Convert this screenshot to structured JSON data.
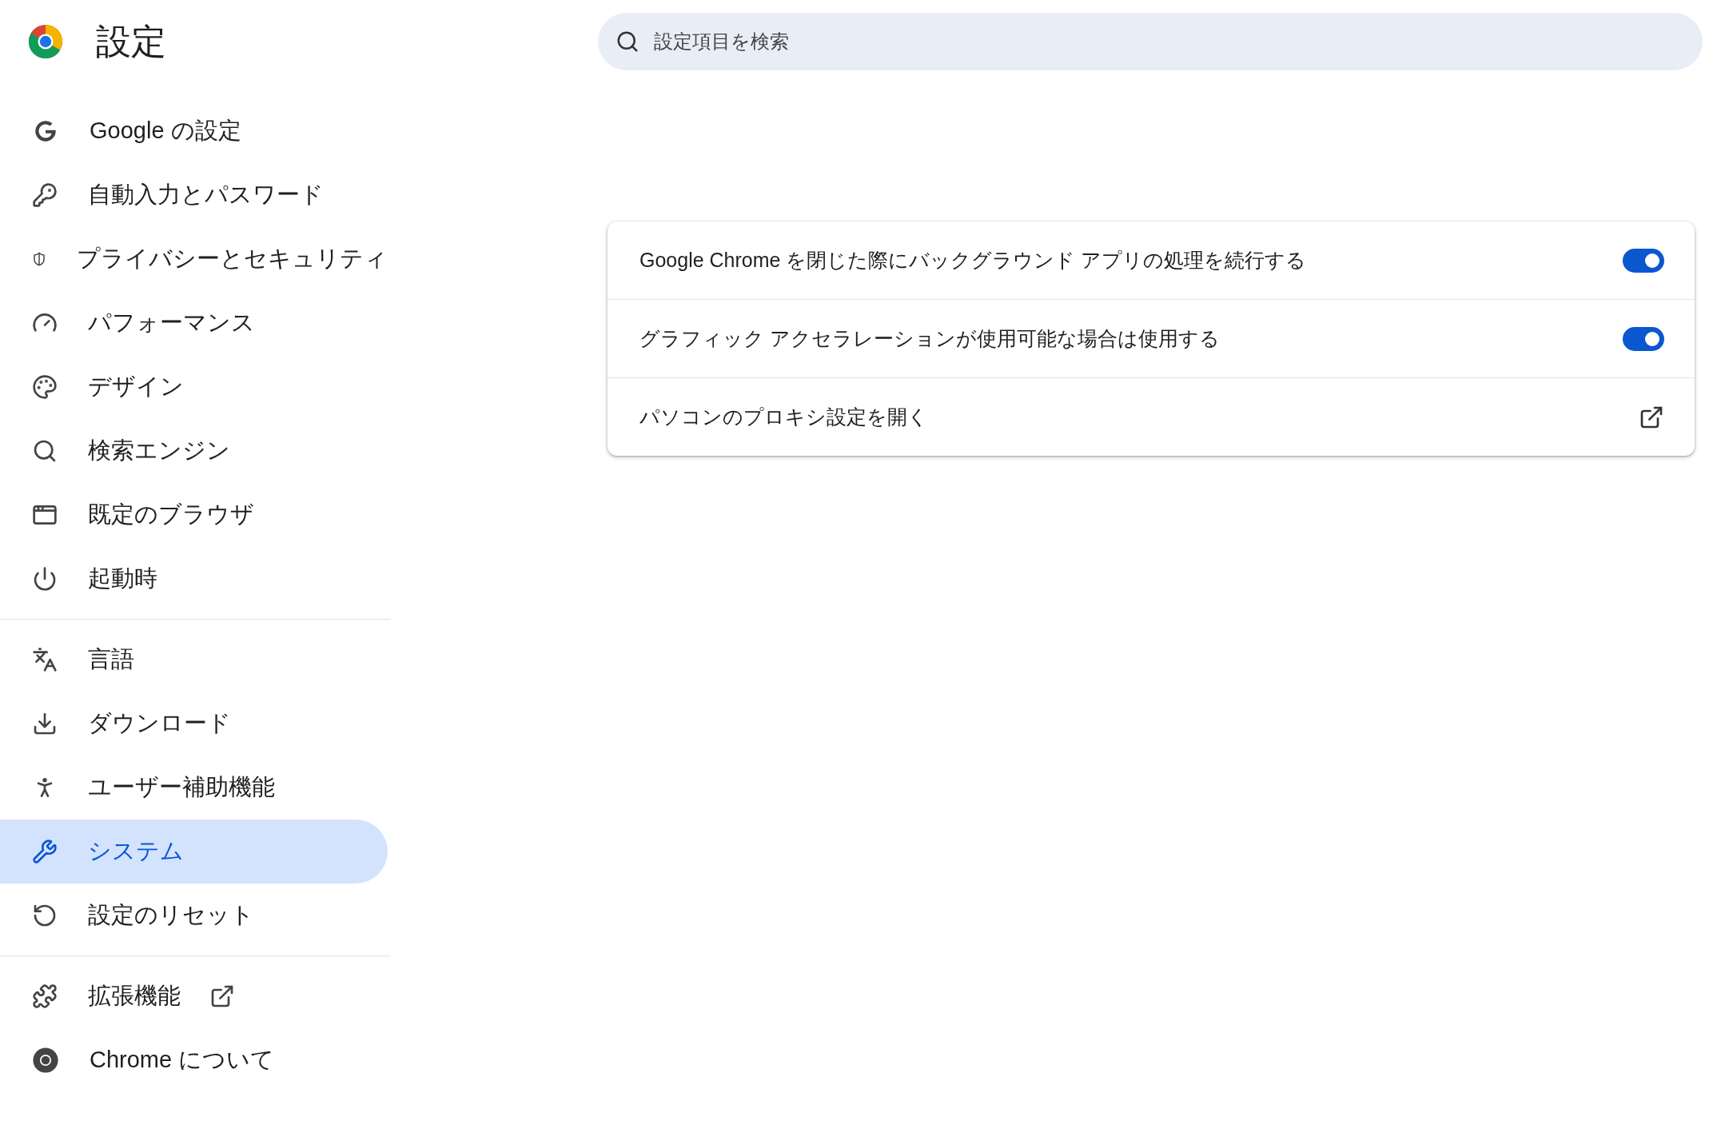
{
  "header": {
    "title": "設定",
    "search": {
      "placeholder": "設定項目を検索"
    }
  },
  "sidebar": {
    "groups": [
      {
        "items": [
          {
            "label": "Google の設定",
            "selected": false
          },
          {
            "label": "自動入力とパスワード",
            "selected": false
          },
          {
            "label": "プライバシーとセキュリティ",
            "selected": false
          },
          {
            "label": "パフォーマンス",
            "selected": false
          },
          {
            "label": "デザイン",
            "selected": false
          },
          {
            "label": "検索エンジン",
            "selected": false
          },
          {
            "label": "既定のブラウザ",
            "selected": false
          },
          {
            "label": "起動時",
            "selected": false
          }
        ]
      },
      {
        "items": [
          {
            "label": "言語",
            "selected": false
          },
          {
            "label": "ダウンロード",
            "selected": false
          },
          {
            "label": "ユーザー補助機能",
            "selected": false
          },
          {
            "label": "システム",
            "selected": true
          },
          {
            "label": "設定のリセット",
            "selected": false
          }
        ]
      },
      {
        "items": [
          {
            "label": "拡張機能",
            "selected": false,
            "external": true
          },
          {
            "label": "Chrome について",
            "selected": false
          }
        ]
      }
    ]
  },
  "settings": [
    {
      "kind": "toggle",
      "label": "Google Chrome を閉じた際にバックグラウンド アプリの処理を続行する",
      "on": true
    },
    {
      "kind": "toggle",
      "label": "グラフィック アクセラレーションが使用可能な場合は使用する",
      "on": true
    },
    {
      "kind": "link",
      "label": "パソコンのプロキシ設定を開く"
    }
  ]
}
